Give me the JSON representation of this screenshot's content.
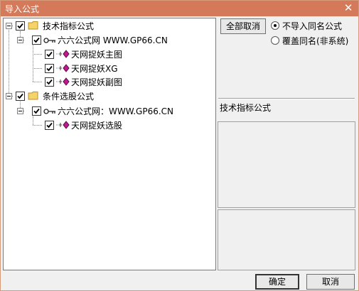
{
  "window": {
    "title": "导入公式",
    "close_glyph": "✕"
  },
  "tree": {
    "groups": [
      {
        "label": "技术指标公式",
        "checked": true,
        "icon": "folder-icon",
        "source": {
          "label": "六六公式网 WWW.GP66.CN",
          "checked": true,
          "icon": "key-icon",
          "items": [
            {
              "label": "天网捉妖主图",
              "checked": true,
              "icon": "formula-icon"
            },
            {
              "label": "天网捉妖XG",
              "checked": true,
              "icon": "formula-icon"
            },
            {
              "label": "天网捉妖副图",
              "checked": true,
              "icon": "formula-icon"
            }
          ]
        }
      },
      {
        "label": "条件选股公式",
        "checked": true,
        "icon": "folder-icon",
        "source": {
          "label": "六六公式网：WWW.GP66.CN",
          "checked": true,
          "icon": "key-icon",
          "items": [
            {
              "label": "天网捉妖选股",
              "checked": true,
              "icon": "formula-icon"
            }
          ]
        }
      }
    ]
  },
  "options": {
    "cancel_all_label": "全部取消",
    "radio_skip_label": "不导入同名公式",
    "radio_overwrite_label": "覆盖同名(非系统)",
    "selected_radio": "skip"
  },
  "detail": {
    "category_label": "技术指标公式"
  },
  "footer": {
    "ok_label": "确定",
    "cancel_label": "取消"
  },
  "colors": {
    "titlebar": "#d4795a",
    "folder": "#f5d36a",
    "formula_icon": "#c01890"
  }
}
